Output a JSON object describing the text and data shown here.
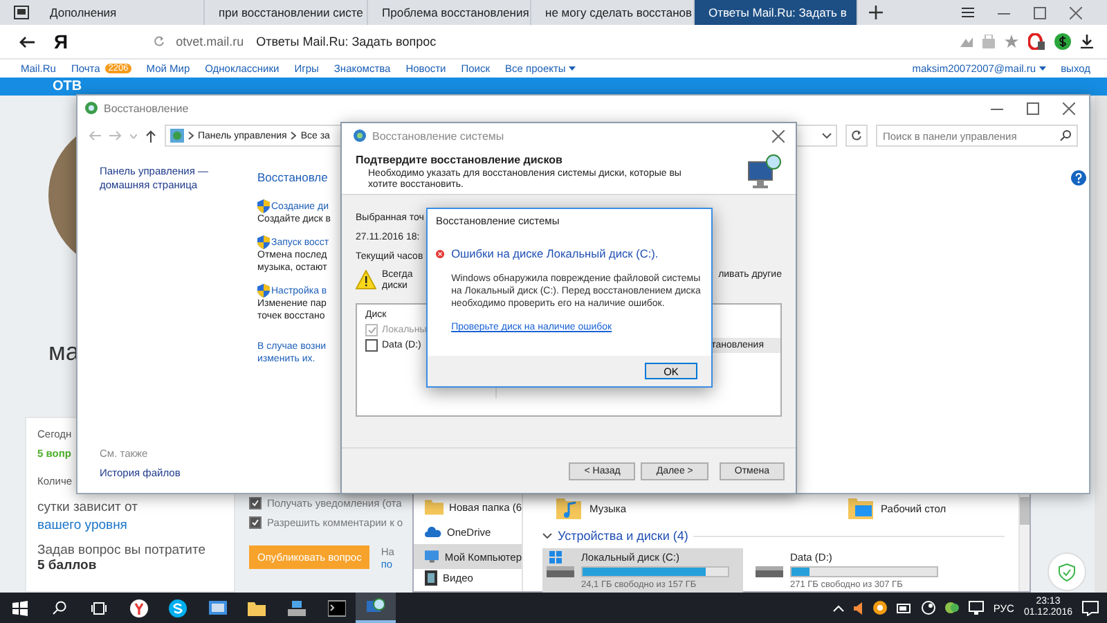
{
  "browser": {
    "tabs": [
      {
        "label": "Дополнения",
        "selected": false
      },
      {
        "label": "при восстановлении систе",
        "selected": false
      },
      {
        "label": "Проблема восстановления",
        "selected": false
      },
      {
        "label": "не могу сделать восстанов",
        "selected": false
      },
      {
        "label": "Ответы Mail.Ru: Задать в",
        "selected": true
      }
    ],
    "logo": "Я",
    "host": "otvet.mail.ru",
    "page_title": "Ответы Mail.Ru: Задать вопрос"
  },
  "portal_nav": {
    "links": [
      {
        "label": "Mail.Ru",
        "kind": "link"
      },
      {
        "label": "Почта",
        "kind": "badge",
        "badge": "2206"
      },
      {
        "label": "Мой Мир",
        "kind": "link"
      },
      {
        "label": "Одноклассники",
        "kind": "link"
      },
      {
        "label": "Игры",
        "kind": "link"
      },
      {
        "label": "Знакомства",
        "kind": "link"
      },
      {
        "label": "Новости",
        "kind": "link"
      },
      {
        "label": "Поиск",
        "kind": "link"
      },
      {
        "label": "Все проекты",
        "kind": "dropdown"
      }
    ],
    "user": "maksim20072007@mail.ru",
    "logout": "выход"
  },
  "page": {
    "logo": "ОТВ",
    "user_name": "ма",
    "stats": [
      {
        "text": "Сегодн",
        "kind": "fragment"
      },
      {
        "text": "5 вопр",
        "kind": "highlight"
      },
      {
        "text": "Количе",
        "kind": "fragment"
      }
    ],
    "level_note": {
      "text": "сутки зависит от",
      "link": "вашего уровня"
    },
    "cost": {
      "label": "Задав вопрос вы потратите",
      "value": "5 баллов"
    },
    "options": [
      {
        "label": "Получать уведомления (ота",
        "checked": true
      },
      {
        "label": "Разрешить комментарии к о",
        "checked": true
      }
    ],
    "publish_button": "Опубликовать вопрос",
    "hint_fragment": "На",
    "link_fragment": "по"
  },
  "control_panel": {
    "title": "Восстановление",
    "breadcrumb": [
      "Панель управления",
      "Все за"
    ],
    "search_placeholder": "Поиск в панели управления",
    "home_link": "Панель управления — домашняя страница",
    "see_also": "См. также",
    "file_history": "История файлов",
    "heading": "Восстановле",
    "tasks": [
      {
        "link": "Создание ди",
        "description": [
          "Создайте диск в"
        ]
      },
      {
        "link": "Запуск восст",
        "description": [
          "Отмена послед",
          "музыка, остают"
        ]
      },
      {
        "link": "Настройка в",
        "description": [
          "Изменение пар",
          "точек восстано"
        ]
      }
    ],
    "footer_link": [
      "В случае возни",
      "изменить их."
    ]
  },
  "wizard": {
    "title": "Восстановление системы",
    "heading": "Подтвердите восстановление дисков",
    "description": "Необходимо указать для восстановления системы диски, которые вы хотите восстановить.",
    "selected_point_label": "Выбранная точ",
    "selected_point_value": "27.11.2016 18:",
    "timezone_label": "Текущий часов",
    "warning": [
      "Всегда",
      "диски"
    ],
    "warning_tail": "ливать другие",
    "table": {
      "column": "Диск",
      "rows": [
        {
          "label": "Локальны",
          "checked": true,
          "disabled": true,
          "extra": ""
        },
        {
          "label": "Data (D:)",
          "checked": false,
          "disabled": false,
          "extra": "тановления"
        }
      ]
    },
    "buttons": [
      "< Назад",
      "Далее >",
      "Отмена"
    ]
  },
  "error_dialog": {
    "title": "Восстановление системы",
    "heading": "Ошибки на диске Локальный диск (C:).",
    "message": "Windows обнаружила повреждение файловой системы на Локальный диск (C:). Перед восстановлением диска необходимо проверить его на наличие ошибок.",
    "link": "Проверьте диск на наличие ошибок",
    "button": "OK"
  },
  "explorer": {
    "nav": [
      {
        "label": "Новая папка (6",
        "selected": false
      },
      {
        "label": "OneDrive",
        "selected": false
      },
      {
        "label": "Мой Компьютер",
        "selected": true
      },
      {
        "label": "Видео",
        "selected": false
      }
    ],
    "folders": [
      "Музыка",
      "Рабочий стол"
    ],
    "group": "Устройства и диски (4)",
    "drives": [
      {
        "name": "Локальный диск (C:)",
        "level": 0.85,
        "free": "24,1 ГБ свободно из 157 ГБ",
        "selected": true
      },
      {
        "name": "Data (D:)",
        "level": 0.12,
        "free": "271 ГБ свободно из 307 ГБ",
        "selected": false
      }
    ]
  },
  "taskbar": {
    "apps": [
      {
        "selected": false
      },
      {
        "selected": false
      },
      {
        "selected": false
      },
      {
        "selected": false
      },
      {
        "selected": false
      },
      {
        "selected": false
      },
      {
        "selected": true
      }
    ],
    "language": "РУС",
    "time": "23:13",
    "date": "01.12.2016"
  }
}
